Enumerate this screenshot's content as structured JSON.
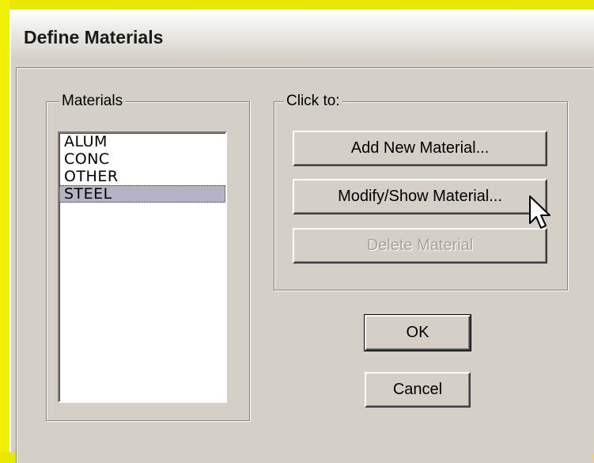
{
  "window": {
    "title": "Define Materials"
  },
  "materials_group": {
    "label": "Materials",
    "items": [
      "ALUM",
      "CONC",
      "OTHER",
      "STEEL"
    ],
    "selected": "STEEL"
  },
  "actions_group": {
    "label": "Click to:",
    "add_label": "Add New Material...",
    "modify_label": "Modify/Show Material...",
    "delete_label": "Delete Material"
  },
  "dialog_buttons": {
    "ok_label": "OK",
    "cancel_label": "Cancel"
  },
  "colors": {
    "dialog_face": "#d4d0c8",
    "selection": "#b4b4c4",
    "background": "#e8e800"
  },
  "icons": {
    "cursor": "arrow-cursor-icon"
  }
}
